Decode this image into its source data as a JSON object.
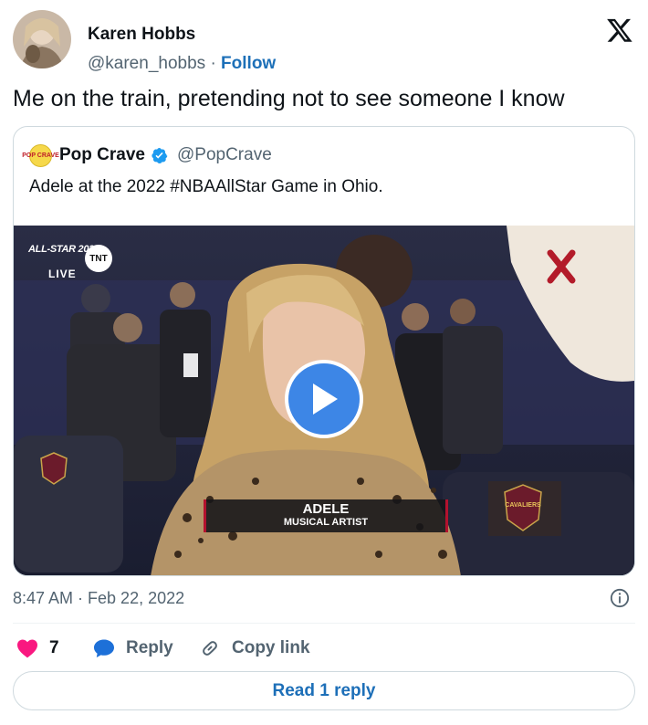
{
  "author": {
    "name": "Karen Hobbs",
    "handle": "@karen_hobbs",
    "separator": "·",
    "follow_label": "Follow"
  },
  "tweet": {
    "text": "Me on the train, pretending not to see someone I know",
    "timestamp": "8:47 AM · Feb 22, 2022"
  },
  "quote": {
    "avatar_text": "POP CRAVE",
    "name": "Pop Crave",
    "handle": "@PopCrave",
    "text": "Adele at the 2022 #NBAAllStar Game in Ohio.",
    "media": {
      "broadcast_bug": "ALL-STAR 2022",
      "network": "TNT",
      "live_label": "LIVE",
      "lower_third_name": "ADELE",
      "lower_third_role": "MUSICAL ARTIST",
      "team_logo_text": "CAVALIERS"
    }
  },
  "actions": {
    "like_count": "7",
    "reply_label": "Reply",
    "copy_link_label": "Copy link"
  },
  "read_reply_label": "Read 1 reply",
  "icons": {
    "x_logo": "x-logo-icon",
    "verified": "verified-badge-icon",
    "play": "play-icon",
    "info": "info-icon",
    "heart": "heart-icon",
    "reply": "speech-bubble-icon",
    "link": "link-icon"
  },
  "colors": {
    "link_blue": "#1d70b8",
    "verified_blue": "#1d9bf0",
    "heart_red": "#f91880",
    "muted_text": "#536471",
    "border": "#cfd9de",
    "play_blue": "#3d86e6"
  }
}
